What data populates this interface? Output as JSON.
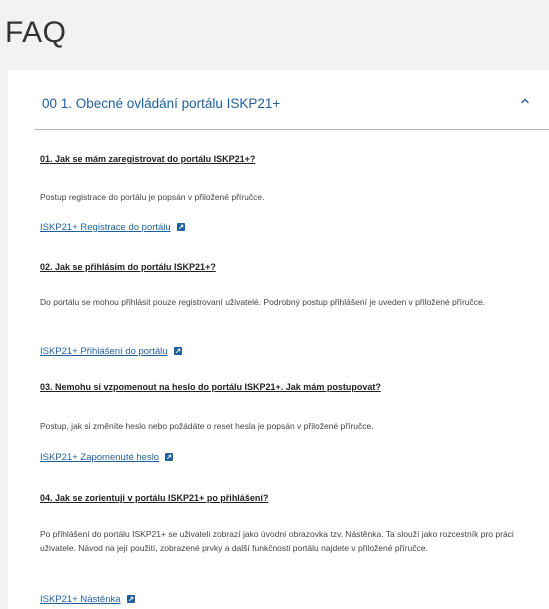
{
  "page": {
    "title": "FAQ"
  },
  "accordion": {
    "title": "00 1. Obecné ovládání portálu ISKP21+",
    "expanded": true,
    "chevron_icon": "chevron-up-icon",
    "link_icon": "external-link-icon",
    "accent_color": "#1f5f9e",
    "items": [
      {
        "question": "01. Jak se mám zaregistrovat do portálu ISKP21+?",
        "answer": "Postup registrace do portálu je popsán v přiložené příručce.",
        "link": "ISKP21+ Registrace do portálu"
      },
      {
        "question": "02. Jak se přihlásím do portálu ISKP21+?",
        "answer": "Do portálu se mohou přihlásit pouze registrovaní uživatelé. Podrobný postup přihlášení je uveden v přiložené příručce.",
        "link": "ISKP21+ Přihlášení do portálu"
      },
      {
        "question": "03. Nemohu si vzpomenout na heslo do portálu ISKP21+. Jak mám postupovat?",
        "answer": "Postup, jak si změníte heslo nebo požádáte o reset hesla je popsán v přiložené příručce.",
        "link": "ISKP21+ Zapomenuté heslo"
      },
      {
        "question": "04. Jak se zorientuji v portálu ISKP21+ po přihlášení?",
        "answer": "Po přihlášení do portálu ISKP21+ se uživateli zobrazí jako úvodní obrazovka tzv. Nástěnka. Ta slouží jako rozcestník pro práci uživatele. Návod na její použití, zobrazené prvky a další funkčnosti portálu najdete v přiložené příručce.",
        "link": "ISKP21+ Nástěnka"
      }
    ]
  }
}
